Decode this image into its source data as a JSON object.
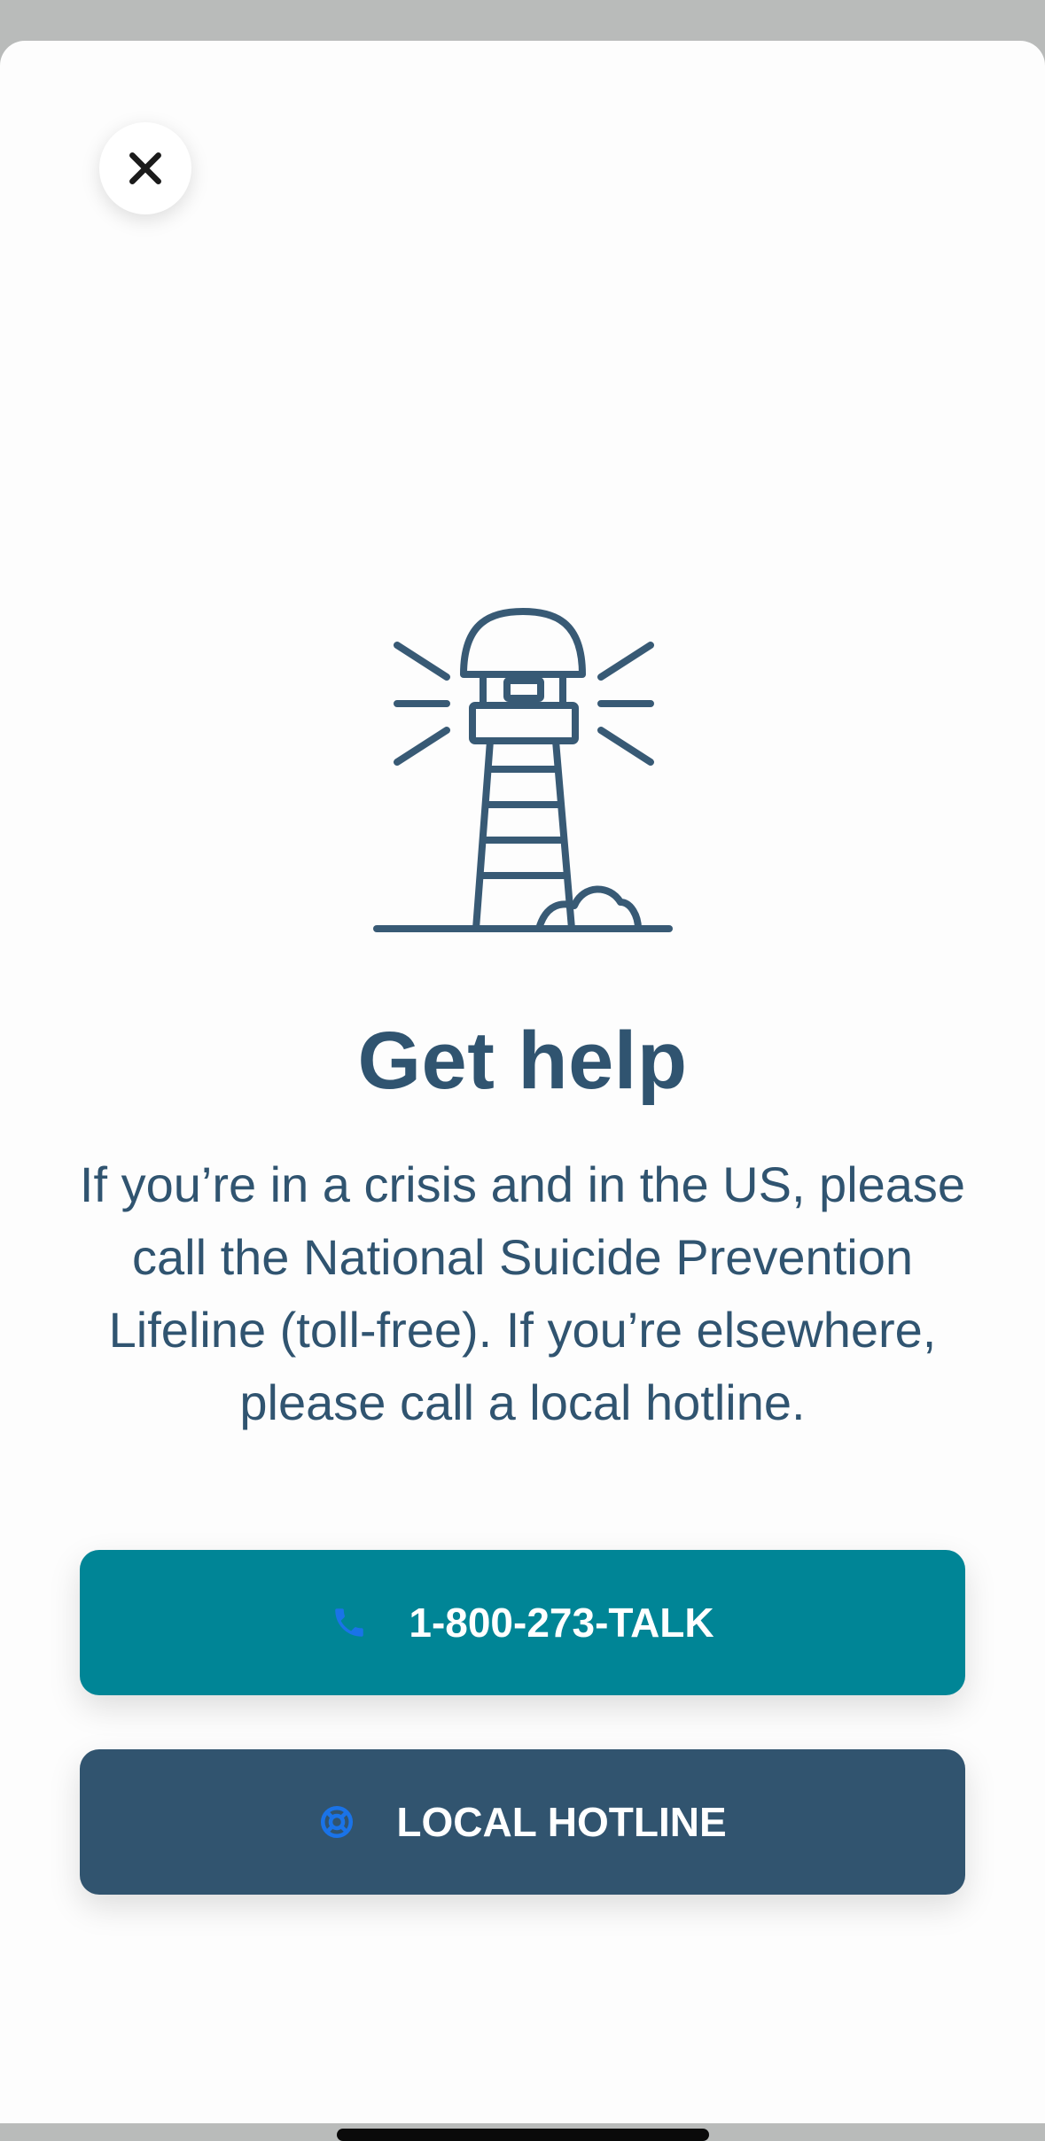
{
  "modal": {
    "close_icon": "close-icon",
    "illustration_icon": "lighthouse-icon",
    "title": "Get help",
    "body": "If you’re in a crisis and in the US, please call the National Suicide Prevention Lifeline (toll-free). If you’re elsewhere, please call a local hotline."
  },
  "actions": {
    "talk": {
      "label": "1-800-273-TALK",
      "icon": "phone-icon",
      "color": "#008596"
    },
    "local": {
      "label": "LOCAL HOTLINE",
      "icon": "lifebuoy-icon",
      "color": "#31546f"
    }
  },
  "colors": {
    "text": "#305470",
    "icon_accent": "#1a73e8"
  }
}
